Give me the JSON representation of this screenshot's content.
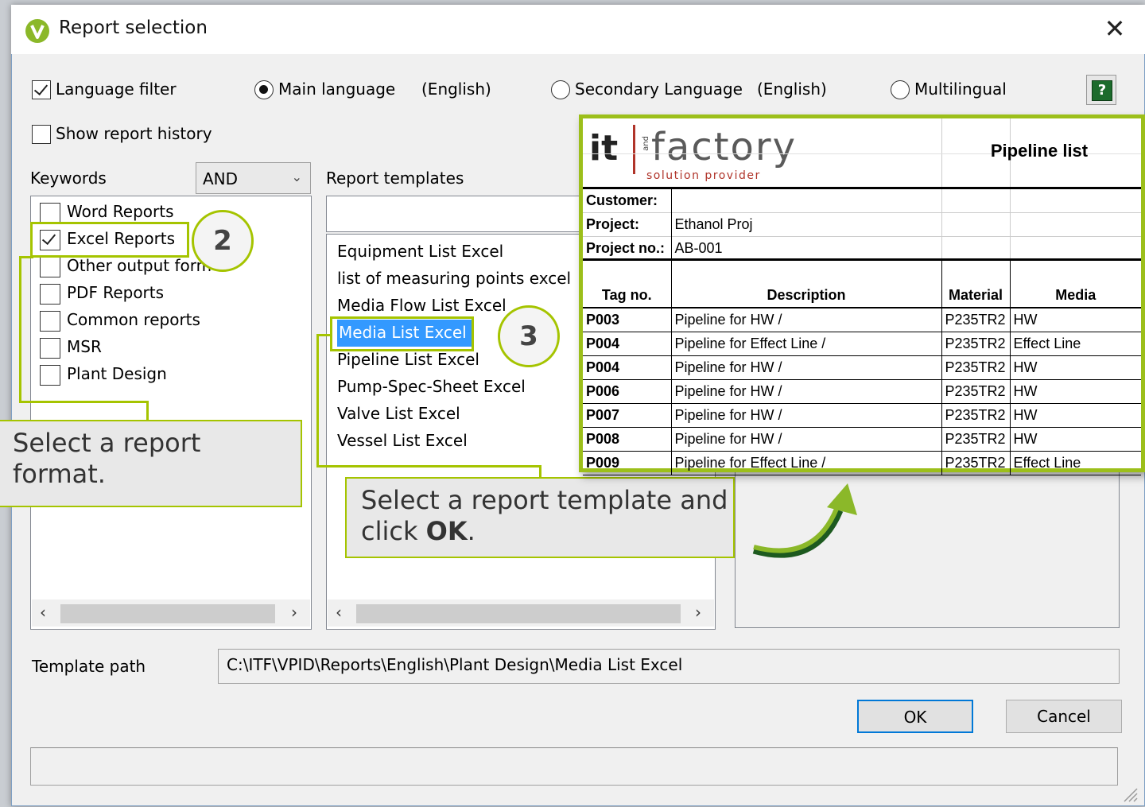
{
  "window": {
    "title": "Report selection",
    "close": "✕"
  },
  "filters": {
    "language_filter": "Language filter",
    "main_language": "Main language",
    "main_language_value": "(English)",
    "secondary_language": "Secondary Language",
    "secondary_language_value": "(English)",
    "multilingual": "Multilingual",
    "show_history": "Show report history",
    "help_glyph": "?"
  },
  "keywords": {
    "label": "Keywords",
    "operator": "AND",
    "items": [
      {
        "label": "Word Reports",
        "checked": false
      },
      {
        "label": "Excel Reports",
        "checked": true
      },
      {
        "label": "Other output form",
        "checked": false
      },
      {
        "label": "PDF Reports",
        "checked": false
      },
      {
        "label": "Common reports",
        "checked": false
      },
      {
        "label": "MSR",
        "checked": false
      },
      {
        "label": "Plant Design",
        "checked": false
      }
    ]
  },
  "templates": {
    "label": "Report templates",
    "search_value": "",
    "items": [
      "Equipment List Excel",
      "list of measuring points excel",
      "Media Flow List Excel",
      "Media List Excel",
      "Pipeline List Excel",
      "Pump-Spec-Sheet Excel",
      "Valve List Excel",
      "Vessel List Excel"
    ],
    "selected": "Media List Excel"
  },
  "template_path": {
    "label": "Template path",
    "value": "C:\\ITF\\VPID\\Reports\\English\\Plant Design\\Media List Excel"
  },
  "buttons": {
    "ok": "OK",
    "cancel": "Cancel"
  },
  "annotations": {
    "step2": "2",
    "step3": "3",
    "callout1": "Select a report format.",
    "callout2_pre": "Select a report template and click ",
    "callout2_bold": "OK",
    "callout2_post": "."
  },
  "preview": {
    "logo_it": "it",
    "logo_and": "and",
    "logo_factory": "factory",
    "logo_sub": "solution provider",
    "title": "Pipeline list",
    "customer_label": "Customer:",
    "customer_value": "",
    "project_label": "Project:",
    "project_value": "Ethanol Proj",
    "project_no_label": "Project no.:",
    "project_no_value": "AB-001",
    "columns": [
      "Tag no.",
      "Description",
      "Material",
      "Media"
    ],
    "rows": [
      [
        "P003",
        "Pipeline for HW /",
        "P235TR2",
        "HW"
      ],
      [
        "P004",
        "Pipeline for Effect Line /",
        "P235TR2",
        "Effect Line"
      ],
      [
        "P004",
        "Pipeline for HW /",
        "P235TR2",
        "HW"
      ],
      [
        "P006",
        "Pipeline for HW /",
        "P235TR2",
        "HW"
      ],
      [
        "P007",
        "Pipeline for HW /",
        "P235TR2",
        "HW"
      ],
      [
        "P008",
        "Pipeline for HW /",
        "P235TR2",
        "HW"
      ],
      [
        "P009",
        "Pipeline for Effect Line /",
        "P235TR2",
        "Effect Line"
      ]
    ]
  },
  "colors": {
    "accent_green": "#a5c400",
    "selection_blue": "#3399ff"
  }
}
